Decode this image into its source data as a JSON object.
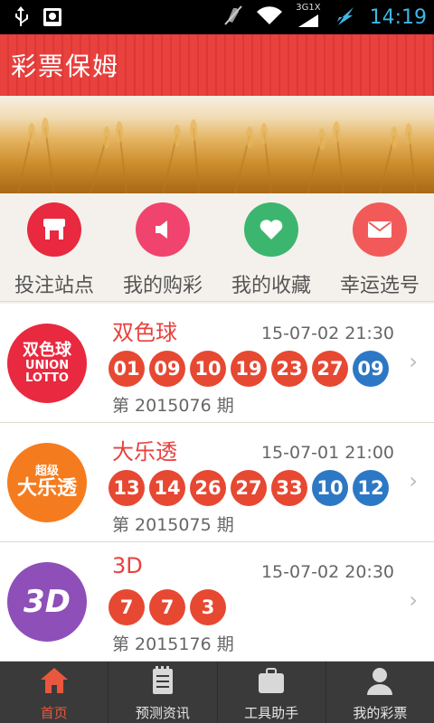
{
  "status_bar": {
    "time": "14:19",
    "network": "3G1X"
  },
  "header": {
    "title": "彩票保姆"
  },
  "quick_menu": [
    {
      "label": "投注站点",
      "icon": "store-icon",
      "color": "#e8293f"
    },
    {
      "label": "我的购彩",
      "icon": "megaphone-icon",
      "color": "#f0446e"
    },
    {
      "label": "我的收藏",
      "icon": "heart-icon",
      "color": "#3cb66e"
    },
    {
      "label": "幸运选号",
      "icon": "envelope-icon",
      "color": "#f25a5a"
    }
  ],
  "lotteries": [
    {
      "name": "双色球",
      "date": "15-07-02 21:30",
      "issue": "第 2015076 期",
      "logo_text": "双色球",
      "logo_sub1": "UNION",
      "logo_sub2": "LOTTO",
      "logo_color": "#e8293f",
      "red": [
        "01",
        "09",
        "10",
        "19",
        "23",
        "27"
      ],
      "blue": [
        "09"
      ]
    },
    {
      "name": "大乐透",
      "date": "15-07-01 21:00",
      "issue": "第 2015075 期",
      "logo_text": "大乐透",
      "logo_sub1": "超级",
      "logo_color": "#f57c1e",
      "red": [
        "13",
        "14",
        "26",
        "27",
        "33"
      ],
      "blue": [
        "10",
        "12"
      ]
    },
    {
      "name": "3D",
      "date": "15-07-02 20:30",
      "issue": "第 2015176 期",
      "logo_text": "3D",
      "logo_color": "#8e4fb8",
      "red": [
        "7",
        "7",
        "3"
      ],
      "blue": []
    }
  ],
  "tabs": [
    {
      "label": "首页",
      "icon": "home-icon",
      "active": true
    },
    {
      "label": "预测资讯",
      "icon": "notepad-icon",
      "active": false
    },
    {
      "label": "工具助手",
      "icon": "briefcase-icon",
      "active": false
    },
    {
      "label": "我的彩票",
      "icon": "person-icon",
      "active": false
    }
  ],
  "colors": {
    "accent": "#e8413e",
    "red_ball": "#e64832",
    "blue_ball": "#2d78c5",
    "tab_active": "#e9573f"
  }
}
